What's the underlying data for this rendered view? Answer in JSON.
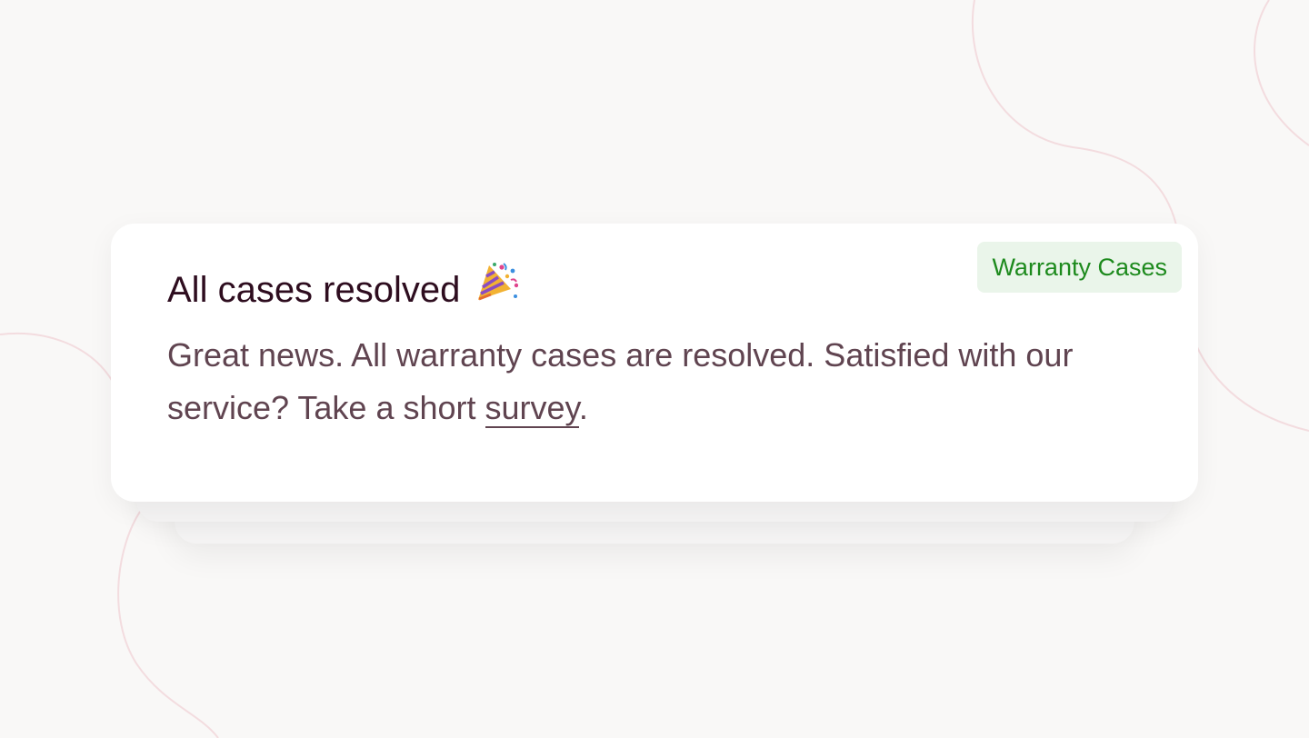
{
  "notification": {
    "title": "All cases resolved",
    "title_icon": "party-popper-icon",
    "tag": "Warranty Cases",
    "message": {
      "text_before_link": "Great news. All warranty cases are resolved. Satisfied with our service? Take a short ",
      "link_text": "survey",
      "text_after_link": "."
    }
  },
  "colors": {
    "page_background": "#f9f8f7",
    "card_background": "#ffffff",
    "title": "#2e0d1f",
    "body_text": "#604450",
    "tag_background": "#eaf5ea",
    "tag_text": "#1d8a1d",
    "decor_lines": "#f3dcdf"
  }
}
